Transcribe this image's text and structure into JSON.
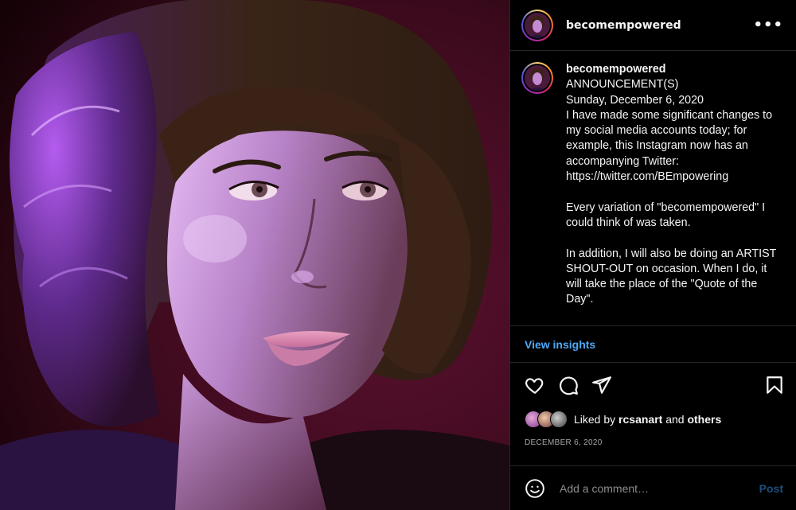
{
  "post": {
    "username": "becomempowered",
    "more_label": "•••",
    "caption_user": "becomempowered",
    "caption": "ANNOUNCEMENT(S)\nSunday, December 6, 2020\nI have made some significant changes to my social media accounts today; for example, this Instagram now has an accompanying Twitter:\nhttps://twitter.com/BEmpowering\n\nEvery variation of \"becomempowered\" I could think of was taken.\n\nIn addition, I will also be doing an ARTIST SHOUT-OUT on occasion. When I do, it will take the place of the \"Quote of the Day\".",
    "insights_label": "View insights",
    "liked_by_prefix": "Liked by ",
    "liked_by_user": "rcsanart",
    "liked_by_and": " and ",
    "liked_by_others": "others",
    "date": "DECEMBER 6, 2020"
  },
  "comment": {
    "placeholder": "Add a comment…",
    "post_label": "Post"
  },
  "icons": {
    "like": "heart-icon",
    "comment": "comment-icon",
    "share": "paper-plane-icon",
    "save": "bookmark-icon",
    "emoji": "emoji-icon",
    "more": "more-icon"
  },
  "colors": {
    "link": "#4fa8f5",
    "post_button": "#1f4e7a",
    "date": "#a8a8a8",
    "divider": "#262626"
  }
}
